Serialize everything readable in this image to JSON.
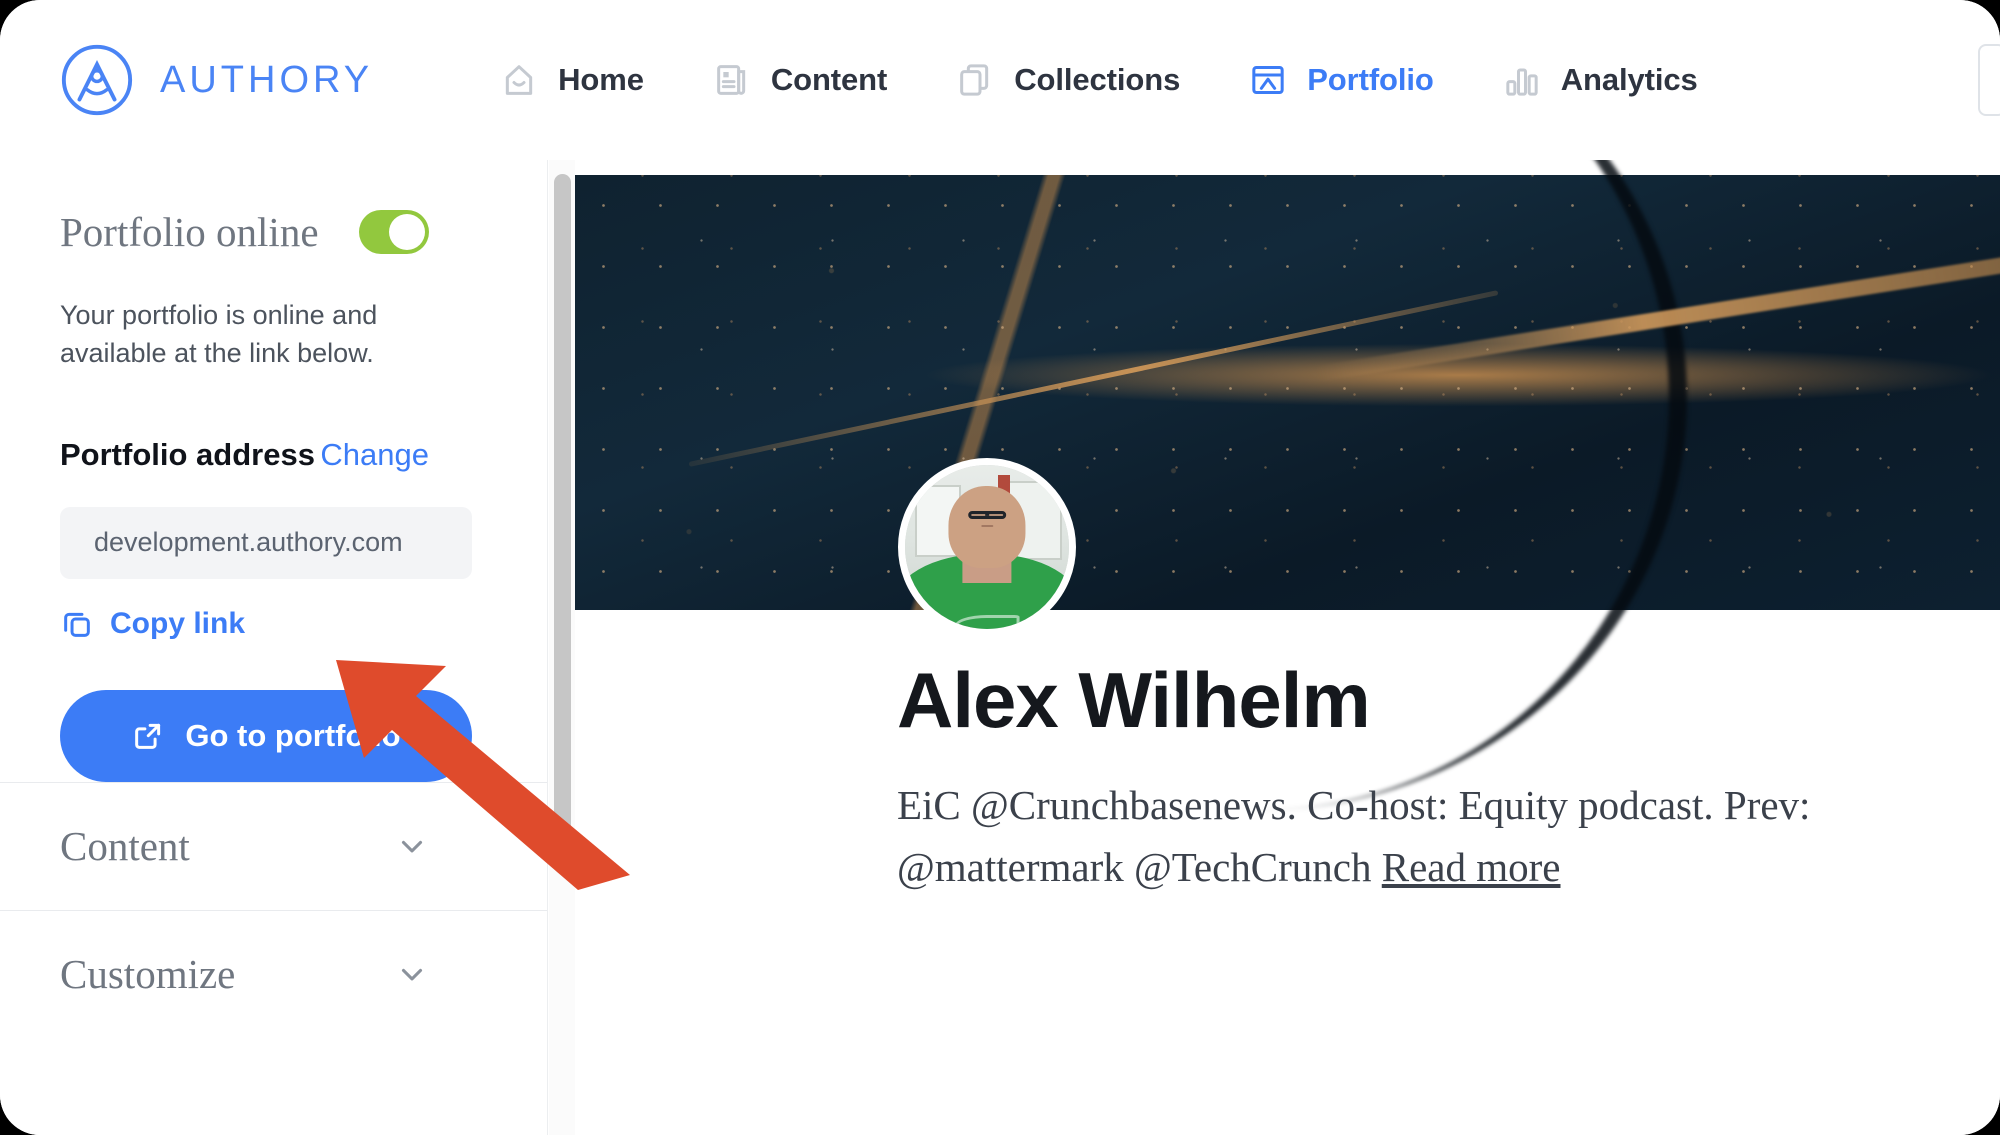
{
  "brand": {
    "name": "AUTHORY",
    "logo_icon": "authory-compass-logo",
    "color": "#4a84f5"
  },
  "nav": {
    "items": [
      {
        "label": "Home",
        "icon": "home-icon",
        "active": false
      },
      {
        "label": "Content",
        "icon": "document-icon",
        "active": false
      },
      {
        "label": "Collections",
        "icon": "collections-icon",
        "active": false
      },
      {
        "label": "Portfolio",
        "icon": "portfolio-icon",
        "active": true
      },
      {
        "label": "Analytics",
        "icon": "bar-chart-icon",
        "active": false
      }
    ],
    "active_color": "#3c7cf6",
    "inactive_color": "#2e3440"
  },
  "sidebar": {
    "online": {
      "title": "Portfolio online",
      "toggle_state": "on",
      "toggle_color": "#92c83e",
      "description": "Your portfolio is online and available at the link below."
    },
    "address": {
      "label": "Portfolio address",
      "change_label": "Change",
      "value": "development.authory.com",
      "placeholder": "development.authory.com"
    },
    "copy_link": {
      "label": "Copy link",
      "icon": "copy-icon"
    },
    "go_to_portfolio": {
      "label": "Go to portfolio",
      "icon": "external-link-icon"
    },
    "accordions": [
      {
        "label": "Content",
        "icon": "chevron-down-icon",
        "expanded": false
      },
      {
        "label": "Customize",
        "icon": "chevron-down-icon",
        "expanded": false
      }
    ]
  },
  "preview": {
    "banner": {
      "description": "dark navy banner with copper streaks and speckles"
    },
    "avatar": {
      "alt": "profile photo of man with glasses in green t-shirt"
    },
    "profile_name": "Alex Wilhelm",
    "bio_text": "EiC @Crunchbasenews. Co-host: Equity podcast. Prev: @mattermark @TechCrunch ",
    "bio_read_more": "Read more"
  },
  "annotation": {
    "arrow_color": "#df4b2c",
    "points_to": "copy-link"
  }
}
